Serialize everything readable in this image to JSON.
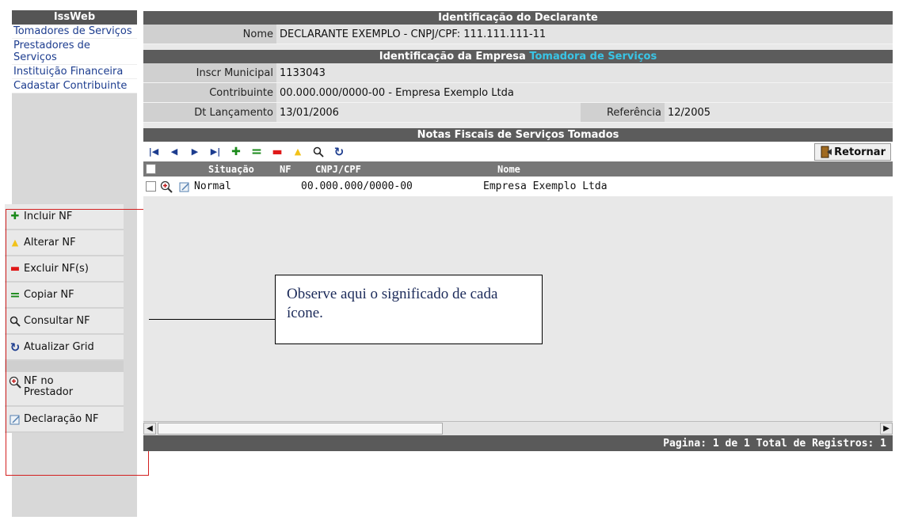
{
  "sidebar": {
    "title": "IssWeb",
    "nav": [
      {
        "label": "Tomadores de Serviços"
      },
      {
        "label": "Prestadores de Serviços"
      },
      {
        "label": "Instituição Financeira"
      },
      {
        "label": "Cadastar Contribuinte"
      }
    ],
    "actions": [
      {
        "icon": "plus-icon",
        "glyph": "✚",
        "color": "#1a8a1a",
        "label": "Incluir NF"
      },
      {
        "icon": "triangle-up-icon",
        "glyph": "▲",
        "color": "#f2c21a",
        "label": "Alterar NF"
      },
      {
        "icon": "minus-icon",
        "glyph": "▬",
        "color": "#e01919",
        "label": "Excluir NF(s)"
      },
      {
        "icon": "equals-icon",
        "glyph": "=",
        "color": "#1a8a1a",
        "label": "Copiar NF"
      },
      {
        "icon": "magnifier-icon",
        "glyph": "🔍︎",
        "color": "#222222",
        "label": "Consultar NF"
      },
      {
        "icon": "refresh-icon",
        "glyph": "↻",
        "color": "#1d3d8f",
        "label": "Atualizar Grid"
      }
    ],
    "extra_actions": [
      {
        "icon": "zoom-plus-icon",
        "glyph": "⊕",
        "color": "#c01818",
        "label_line1": "NF no",
        "label_line2": "Prestador"
      },
      {
        "icon": "edit-note-icon",
        "glyph": "✎",
        "color": "#5580b0",
        "label": "Declaração NF"
      }
    ]
  },
  "declarante": {
    "header": "Identificação do Declarante",
    "nome_label": "Nome",
    "nome_value": "DECLARANTE EXEMPLO - CNPJ/CPF: 111.111.111-11"
  },
  "empresa": {
    "header_prefix": "Identificação da Empresa",
    "header_highlight": "Tomadora de Serviços",
    "inscr_label": "Inscr Municipal",
    "inscr_value": "1133043",
    "contrib_label": "Contribuinte",
    "contrib_value": "00.000.000/0000-00 - Empresa Exemplo Ltda",
    "dt_label": "Dt Lançamento",
    "dt_value": "13/01/2006",
    "ref_label": "Referência",
    "ref_value": "12/2005"
  },
  "notas": {
    "header": "Notas Fiscais de Serviços Tomados",
    "retornar_label": "Retornar",
    "columns": [
      "Situação",
      "NF",
      "CNPJ/CPF",
      "Nome"
    ],
    "rows": [
      {
        "situacao": "Normal",
        "nf": "",
        "cnpj": "00.000.000/0000-00",
        "nome": "Empresa Exemplo Ltda"
      }
    ],
    "footer": "Pagina: 1 de 1 Total de Registros: 1"
  },
  "callout": {
    "text": "Observe aqui o significado de cada ícone."
  },
  "colors": {
    "header_bg": "#5c5c5c",
    "highlight": "#39c5e6",
    "link": "#1d3d8f",
    "annotation_box": "#d32020"
  }
}
